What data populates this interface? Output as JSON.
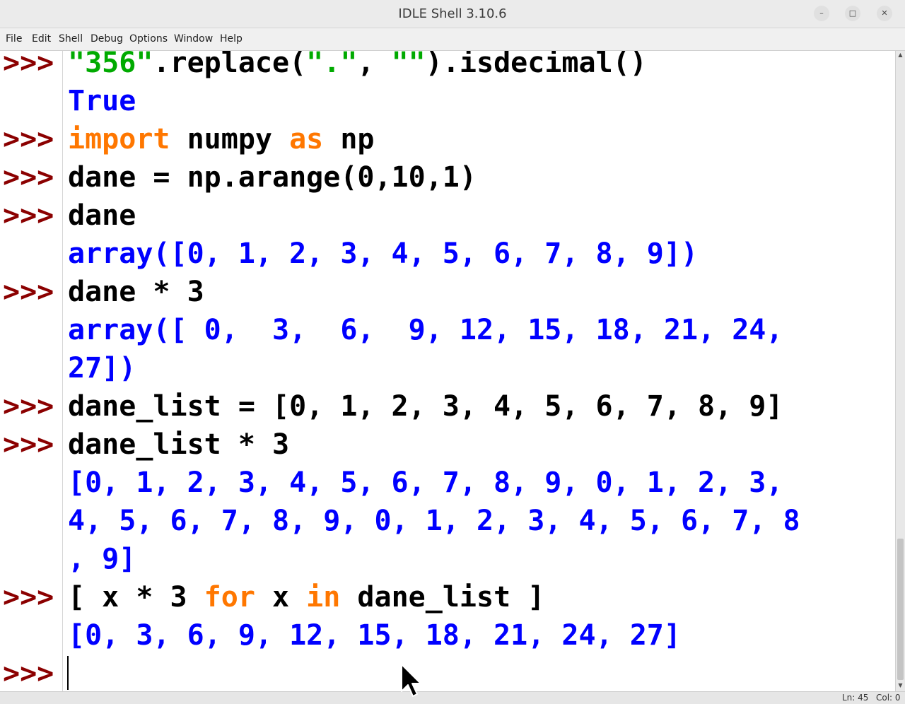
{
  "window": {
    "title": "IDLE Shell 3.10.6"
  },
  "menu": [
    "File",
    "Edit",
    "Shell",
    "Debug",
    "Options",
    "Window",
    "Help"
  ],
  "prompt": ">>>",
  "shell": {
    "l0": {
      "a": "\"356\"",
      "b": ".replace(",
      "c": "\".\"",
      "d": ", ",
      "e": "\"\"",
      "f": ").isdecimal()"
    },
    "l1": "True",
    "l2": {
      "kw1": "import",
      "mid": " numpy ",
      "kw2": "as",
      "end": " np"
    },
    "l3": "dane = np.arange(0,10,1)",
    "l4": "dane",
    "l5": "array([0, 1, 2, 3, 4, 5, 6, 7, 8, 9])",
    "l6": "dane * 3",
    "l7": "array([ 0,  3,  6,  9, 12, 15, 18, 21, 24,",
    "l8": "27])",
    "l9": "dane_list = [0, 1, 2, 3, 4, 5, 6, 7, 8, 9]",
    "l10": "dane_list * 3",
    "l11": "[0, 1, 2, 3, 4, 5, 6, 7, 8, 9, 0, 1, 2, 3,",
    "l12": "4, 5, 6, 7, 8, 9, 0, 1, 2, 3, 4, 5, 6, 7, 8",
    "l13": ", 9]",
    "l14": {
      "a": "[ x * 3 ",
      "kw1": "for",
      "b": " x ",
      "kw2": "in",
      "c": " dane_list ]"
    },
    "l15": "[0, 3, 6, 9, 12, 15, 18, 21, 24, 27]"
  },
  "status": {
    "ln": "Ln: 45",
    "col": "Col: 0"
  },
  "colors": {
    "prompt": "#8b0000",
    "keyword": "#ff7700",
    "string": "#00aa00",
    "output": "#0000ff"
  }
}
